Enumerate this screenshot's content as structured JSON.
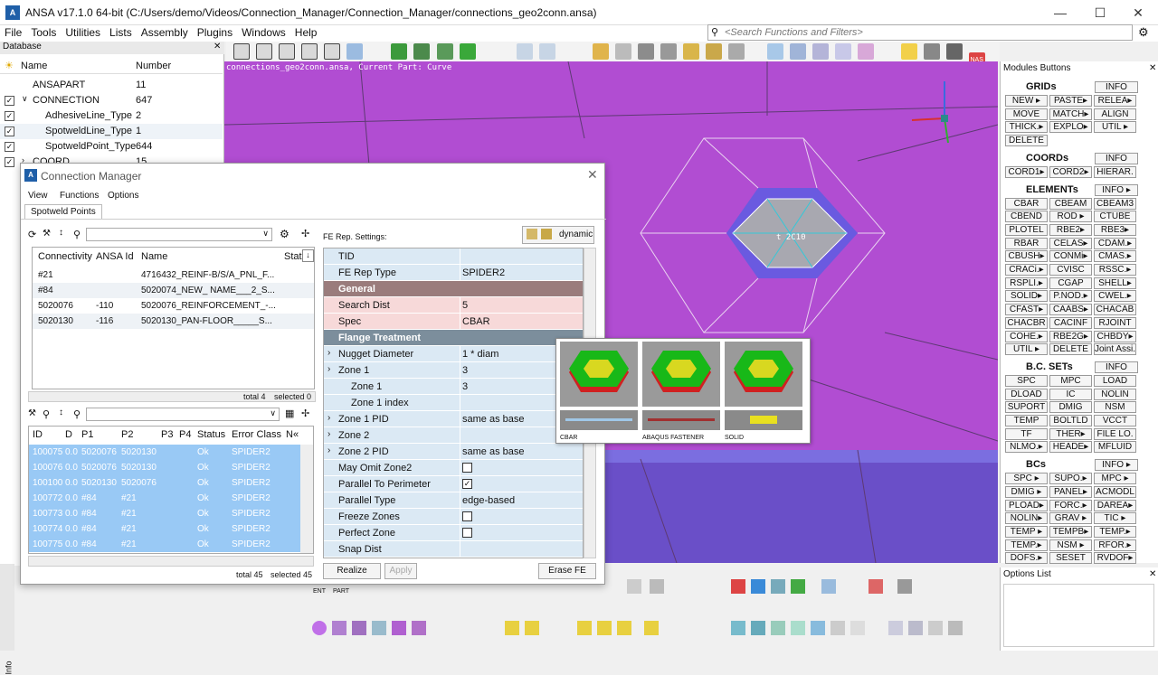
{
  "window": {
    "title": "ANSA v17.1.0 64-bit (C:/Users/demo/Videos/Connection_Manager/Connection_Manager/connections_geo2conn.ansa)",
    "icon_text": "A"
  },
  "menu": [
    "File",
    "Tools",
    "Utilities",
    "Lists",
    "Assembly",
    "Plugins",
    "Windows",
    "Help"
  ],
  "search": {
    "placeholder": "<Search Functions and Filters>"
  },
  "database": {
    "title": "Database",
    "col_name": "Name",
    "col_number": "Number",
    "rows": [
      {
        "name": "ANSAPART",
        "number": "11"
      },
      {
        "name": "CONNECTION",
        "number": "647"
      },
      {
        "name": "AdhesiveLine_Type",
        "number": "2"
      },
      {
        "name": "SpotweldLine_Type",
        "number": "1"
      },
      {
        "name": "SpotweldPoint_Type",
        "number": "644"
      },
      {
        "name": "COORD",
        "number": "15"
      }
    ]
  },
  "viewport": {
    "label": "connections_geo2conn.ansa,  Current Part: Curve",
    "element_label": "t  2C10"
  },
  "dialog": {
    "title": "Connection Manager",
    "menus": [
      "View",
      "Functions",
      "Options"
    ],
    "tab": "Spotweld Points",
    "top_table": {
      "headers": [
        "Connectivity",
        "ANSA Id",
        "Name",
        "Stat"
      ],
      "rows": [
        {
          "c": "#21",
          "id": "",
          "name": "4716432_REINF-B/S/A_PNL_F..."
        },
        {
          "c": "#84",
          "id": "",
          "name": "5020074_NEW_ NAME___2_S..."
        },
        {
          "c": "5020076",
          "id": "-110",
          "name": "5020076_REINFORCEMENT_-..."
        },
        {
          "c": "5020130",
          "id": "-116",
          "name": "5020130_PAN-FLOOR_____S..."
        }
      ],
      "total": "total 4",
      "selected": "selected 0"
    },
    "bottom_table": {
      "headers": [
        "ID",
        "D",
        "P1",
        "P2",
        "P3",
        "P4",
        "Status",
        "Error Class",
        "N«"
      ],
      "rows": [
        {
          "id": "100075",
          "d": "0.0",
          "p1": "5020076",
          "p2": "5020130",
          "st": "Ok",
          "ec": "SPIDER2"
        },
        {
          "id": "100076",
          "d": "0.0",
          "p1": "5020076",
          "p2": "5020130",
          "st": "Ok",
          "ec": "SPIDER2"
        },
        {
          "id": "100100",
          "d": "0.0",
          "p1": "5020130",
          "p2": "5020076",
          "st": "Ok",
          "ec": "SPIDER2"
        },
        {
          "id": "100772",
          "d": "0.0",
          "p1": "#84",
          "p2": "#21",
          "st": "Ok",
          "ec": "SPIDER2"
        },
        {
          "id": "100773",
          "d": "0.0",
          "p1": "#84",
          "p2": "#21",
          "st": "Ok",
          "ec": "SPIDER2"
        },
        {
          "id": "100774",
          "d": "0.0",
          "p1": "#84",
          "p2": "#21",
          "st": "Ok",
          "ec": "SPIDER2"
        },
        {
          "id": "100775",
          "d": "0.0",
          "p1": "#84",
          "p2": "#21",
          "st": "Ok",
          "ec": "SPIDER2"
        }
      ],
      "total": "total 45",
      "selected": "selected 45"
    },
    "fe_settings_label": "FE Rep. Settings:",
    "dynamic_label": "dynamic",
    "props": [
      {
        "k": "TID",
        "v": "",
        "type": "plain"
      },
      {
        "k": "FE Rep Type",
        "v": "SPIDER2",
        "type": "plain"
      },
      {
        "k": "General",
        "v": "",
        "type": "group"
      },
      {
        "k": "Search Dist",
        "v": "5",
        "type": "pink"
      },
      {
        "k": "Spec",
        "v": "CBAR",
        "type": "pink"
      },
      {
        "k": "Flange Treatment",
        "v": "",
        "type": "group2"
      },
      {
        "k": "Nugget Diameter",
        "v": "1 * diam",
        "type": "expand"
      },
      {
        "k": "Zone 1",
        "v": "3",
        "type": "expand"
      },
      {
        "k": "Zone 1",
        "v": "3",
        "type": "sub"
      },
      {
        "k": "Zone 1 index",
        "v": "",
        "type": "sub"
      },
      {
        "k": "Zone 1 PID",
        "v": "same as base",
        "type": "expand"
      },
      {
        "k": "Zone 2",
        "v": "",
        "type": "expand"
      },
      {
        "k": "Zone 2 PID",
        "v": "same as base",
        "type": "expand"
      },
      {
        "k": "May Omit Zone2",
        "v": "",
        "type": "check"
      },
      {
        "k": "Parallel To Perimeter",
        "v": "",
        "type": "checked"
      },
      {
        "k": "Parallel Type",
        "v": "edge-based",
        "type": "plain"
      },
      {
        "k": "Freeze Zones",
        "v": "",
        "type": "check"
      },
      {
        "k": "Perfect Zone",
        "v": "",
        "type": "check"
      },
      {
        "k": "Snap Dist",
        "v": "",
        "type": "plain"
      }
    ],
    "buttons": {
      "realize": "Realize",
      "apply": "Apply",
      "erase": "Erase FE"
    }
  },
  "preview": {
    "labels": [
      "CBAR",
      "ABAQUS FASTENER",
      "SOLID"
    ]
  },
  "modules": {
    "title": "Modules Buttons",
    "sections": [
      {
        "name": "GRIDs",
        "info": "INFO",
        "buttons": [
          "NEW ▸",
          "PASTE▸",
          "RELEA▸",
          "MOVE",
          "MATCH▸",
          "ALIGN",
          "THICK.▸",
          "EXPLO▸",
          "UTIL ▸",
          "DELETE"
        ]
      },
      {
        "name": "COORDs",
        "info": "INFO",
        "buttons": [
          "CORD1▸",
          "CORD2▸",
          "HIERAR."
        ]
      },
      {
        "name": "ELEMENTs",
        "info": "INFO ▸",
        "buttons": [
          "CBAR",
          "CBEAM",
          "CBEAM3",
          "CBEND",
          "ROD ▸",
          "CTUBE",
          "PLOTEL",
          "RBE2▸",
          "RBE3▸",
          "RBAR",
          "CELAS▸",
          "CDAM.▸",
          "CBUSH▸",
          "CONMi▸",
          "CMAS.▸",
          "CRACi.▸",
          "CVISC",
          "RSSC.▸",
          "RSPLI.▸",
          "CGAP",
          "SHELL▸",
          "SOLID▸",
          "P.NOD.▸",
          "CWEL.▸",
          "CFAST▸",
          "CAABS▸",
          "CHACAB",
          "CHACBR",
          "CACINF",
          "RJOINT",
          "COHE.▸",
          "RBE2G▸",
          "CHBDY▸",
          "UTIL ▸",
          "DELETE",
          "Joint Assi."
        ]
      },
      {
        "name": "B.C. SETs",
        "info": "INFO",
        "buttons": [
          "SPC",
          "MPC",
          "LOAD",
          "DLOAD",
          "IC",
          "NOLIN",
          "SUPORT",
          "DMIG",
          "NSM",
          "TEMP",
          "BOLTLD",
          "VCCT",
          "TF",
          "THER▸",
          "FILE LO.",
          "NLMO.▸",
          "HEADE▸",
          "MFLUID"
        ]
      },
      {
        "name": "BCs",
        "info": "INFO ▸",
        "buttons": [
          "SPC ▸",
          "SUPO.▸",
          "MPC ▸",
          "DMIG ▸",
          "PANEL▸",
          "ACMODL",
          "PLOAD▸",
          "FORC.▸",
          "DAREA▸",
          "NOLIN▸",
          "GRAV ▸",
          "TIC ▸",
          "TEMP ▸",
          "TEMPB▸",
          "TEMP.▸",
          "TEMP.▸",
          "NSM ▸",
          "RFOR.▸",
          "DOFS.▸",
          "SESET",
          "RVDOF▸"
        ]
      }
    ]
  },
  "options_list": {
    "title": "Options List"
  },
  "bottom": {
    "ent": "ENT",
    "part": "PART",
    "info": "Info"
  },
  "colors": {
    "viewport": "#b14dd2",
    "selection": "#99c9f5",
    "accent": "#1f5fa8"
  }
}
